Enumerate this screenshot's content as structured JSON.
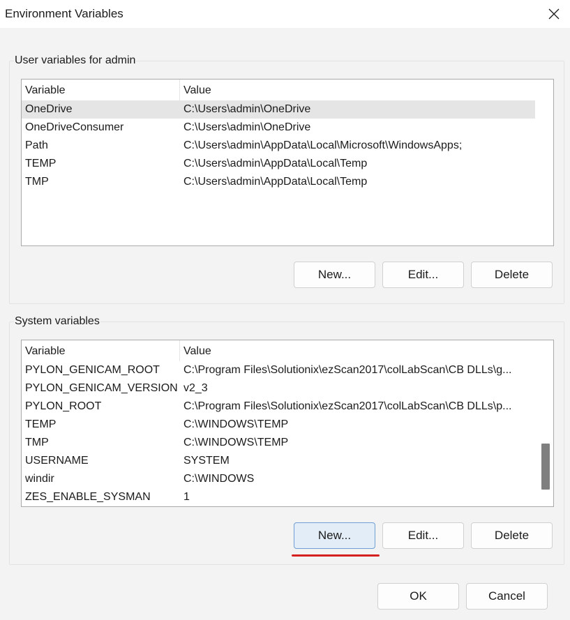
{
  "window": {
    "title": "Environment Variables",
    "close_icon": "close-icon"
  },
  "user_vars": {
    "group_label": "User variables for admin",
    "columns": [
      "Variable",
      "Value"
    ],
    "rows": [
      {
        "name": "OneDrive",
        "value": "C:\\Users\\admin\\OneDrive",
        "selected": true
      },
      {
        "name": "OneDriveConsumer",
        "value": "C:\\Users\\admin\\OneDrive",
        "selected": false
      },
      {
        "name": "Path",
        "value": "C:\\Users\\admin\\AppData\\Local\\Microsoft\\WindowsApps;",
        "selected": false
      },
      {
        "name": "TEMP",
        "value": "C:\\Users\\admin\\AppData\\Local\\Temp",
        "selected": false
      },
      {
        "name": "TMP",
        "value": "C:\\Users\\admin\\AppData\\Local\\Temp",
        "selected": false
      }
    ],
    "buttons": {
      "new": "New...",
      "edit": "Edit...",
      "delete": "Delete"
    }
  },
  "system_vars": {
    "group_label": "System variables",
    "columns": [
      "Variable",
      "Value"
    ],
    "rows": [
      {
        "name": "PYLON_GENICAM_ROOT",
        "value": "C:\\Program Files\\Solutionix\\ezScan2017\\colLabScan\\CB DLLs\\g..."
      },
      {
        "name": "PYLON_GENICAM_VERSION",
        "value": "v2_3"
      },
      {
        "name": "PYLON_ROOT",
        "value": "C:\\Program Files\\Solutionix\\ezScan2017\\colLabScan\\CB DLLs\\p..."
      },
      {
        "name": "TEMP",
        "value": "C:\\WINDOWS\\TEMP"
      },
      {
        "name": "TMP",
        "value": "C:\\WINDOWS\\TEMP"
      },
      {
        "name": "USERNAME",
        "value": "SYSTEM"
      },
      {
        "name": "windir",
        "value": "C:\\WINDOWS"
      },
      {
        "name": "ZES_ENABLE_SYSMAN",
        "value": "1"
      }
    ],
    "buttons": {
      "new": "New...",
      "edit": "Edit...",
      "delete": "Delete"
    }
  },
  "footer": {
    "ok": "OK",
    "cancel": "Cancel"
  },
  "colors": {
    "focus_button": "#e3edf8",
    "highlight_underline": "#d62020",
    "selection": "#e5e5e5"
  }
}
